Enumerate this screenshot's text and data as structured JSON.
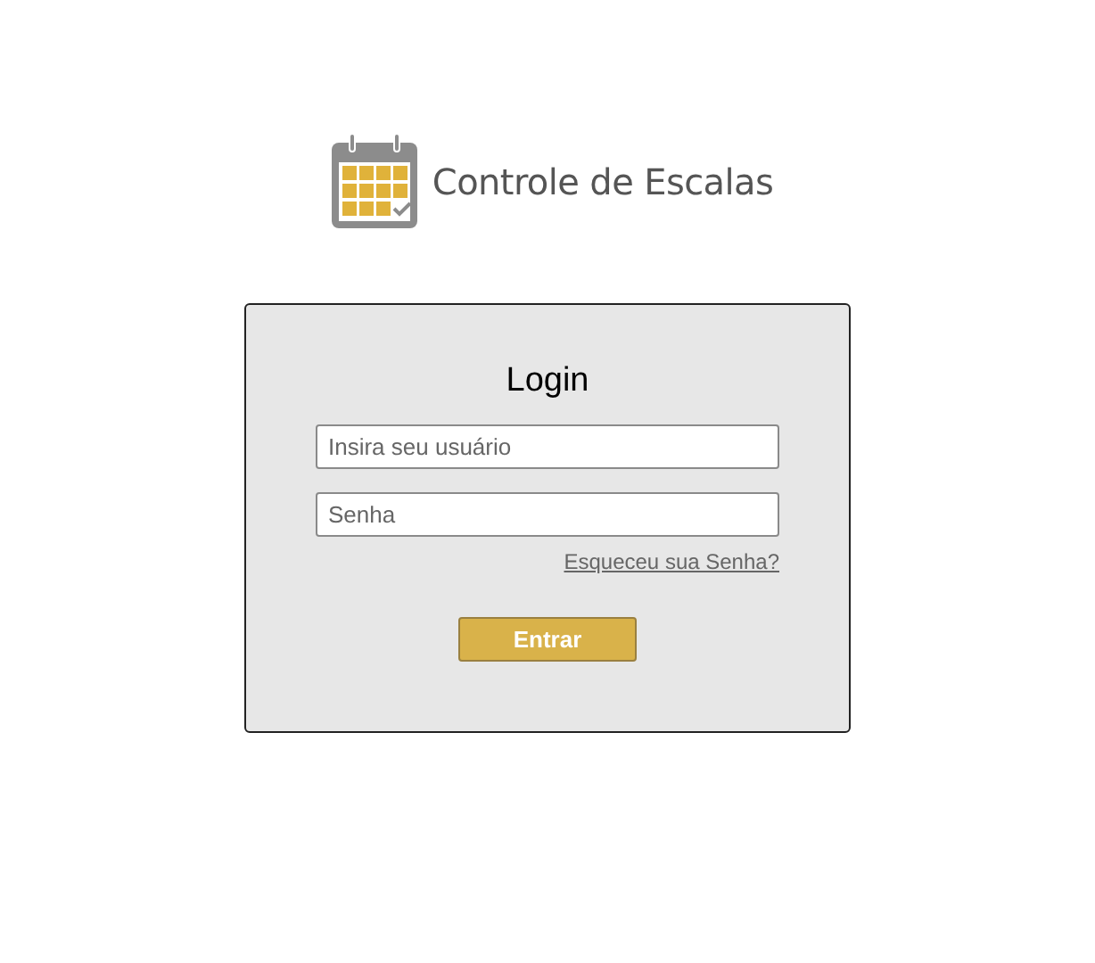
{
  "brand": {
    "title": "Controle de Escalas"
  },
  "login": {
    "title": "Login",
    "fields": [
      {
        "placeholder": "Insira seu usuário"
      },
      {
        "placeholder": "Senha"
      }
    ],
    "forgot_link": "Esqueceu sua Senha?",
    "submit": "Entrar"
  }
}
